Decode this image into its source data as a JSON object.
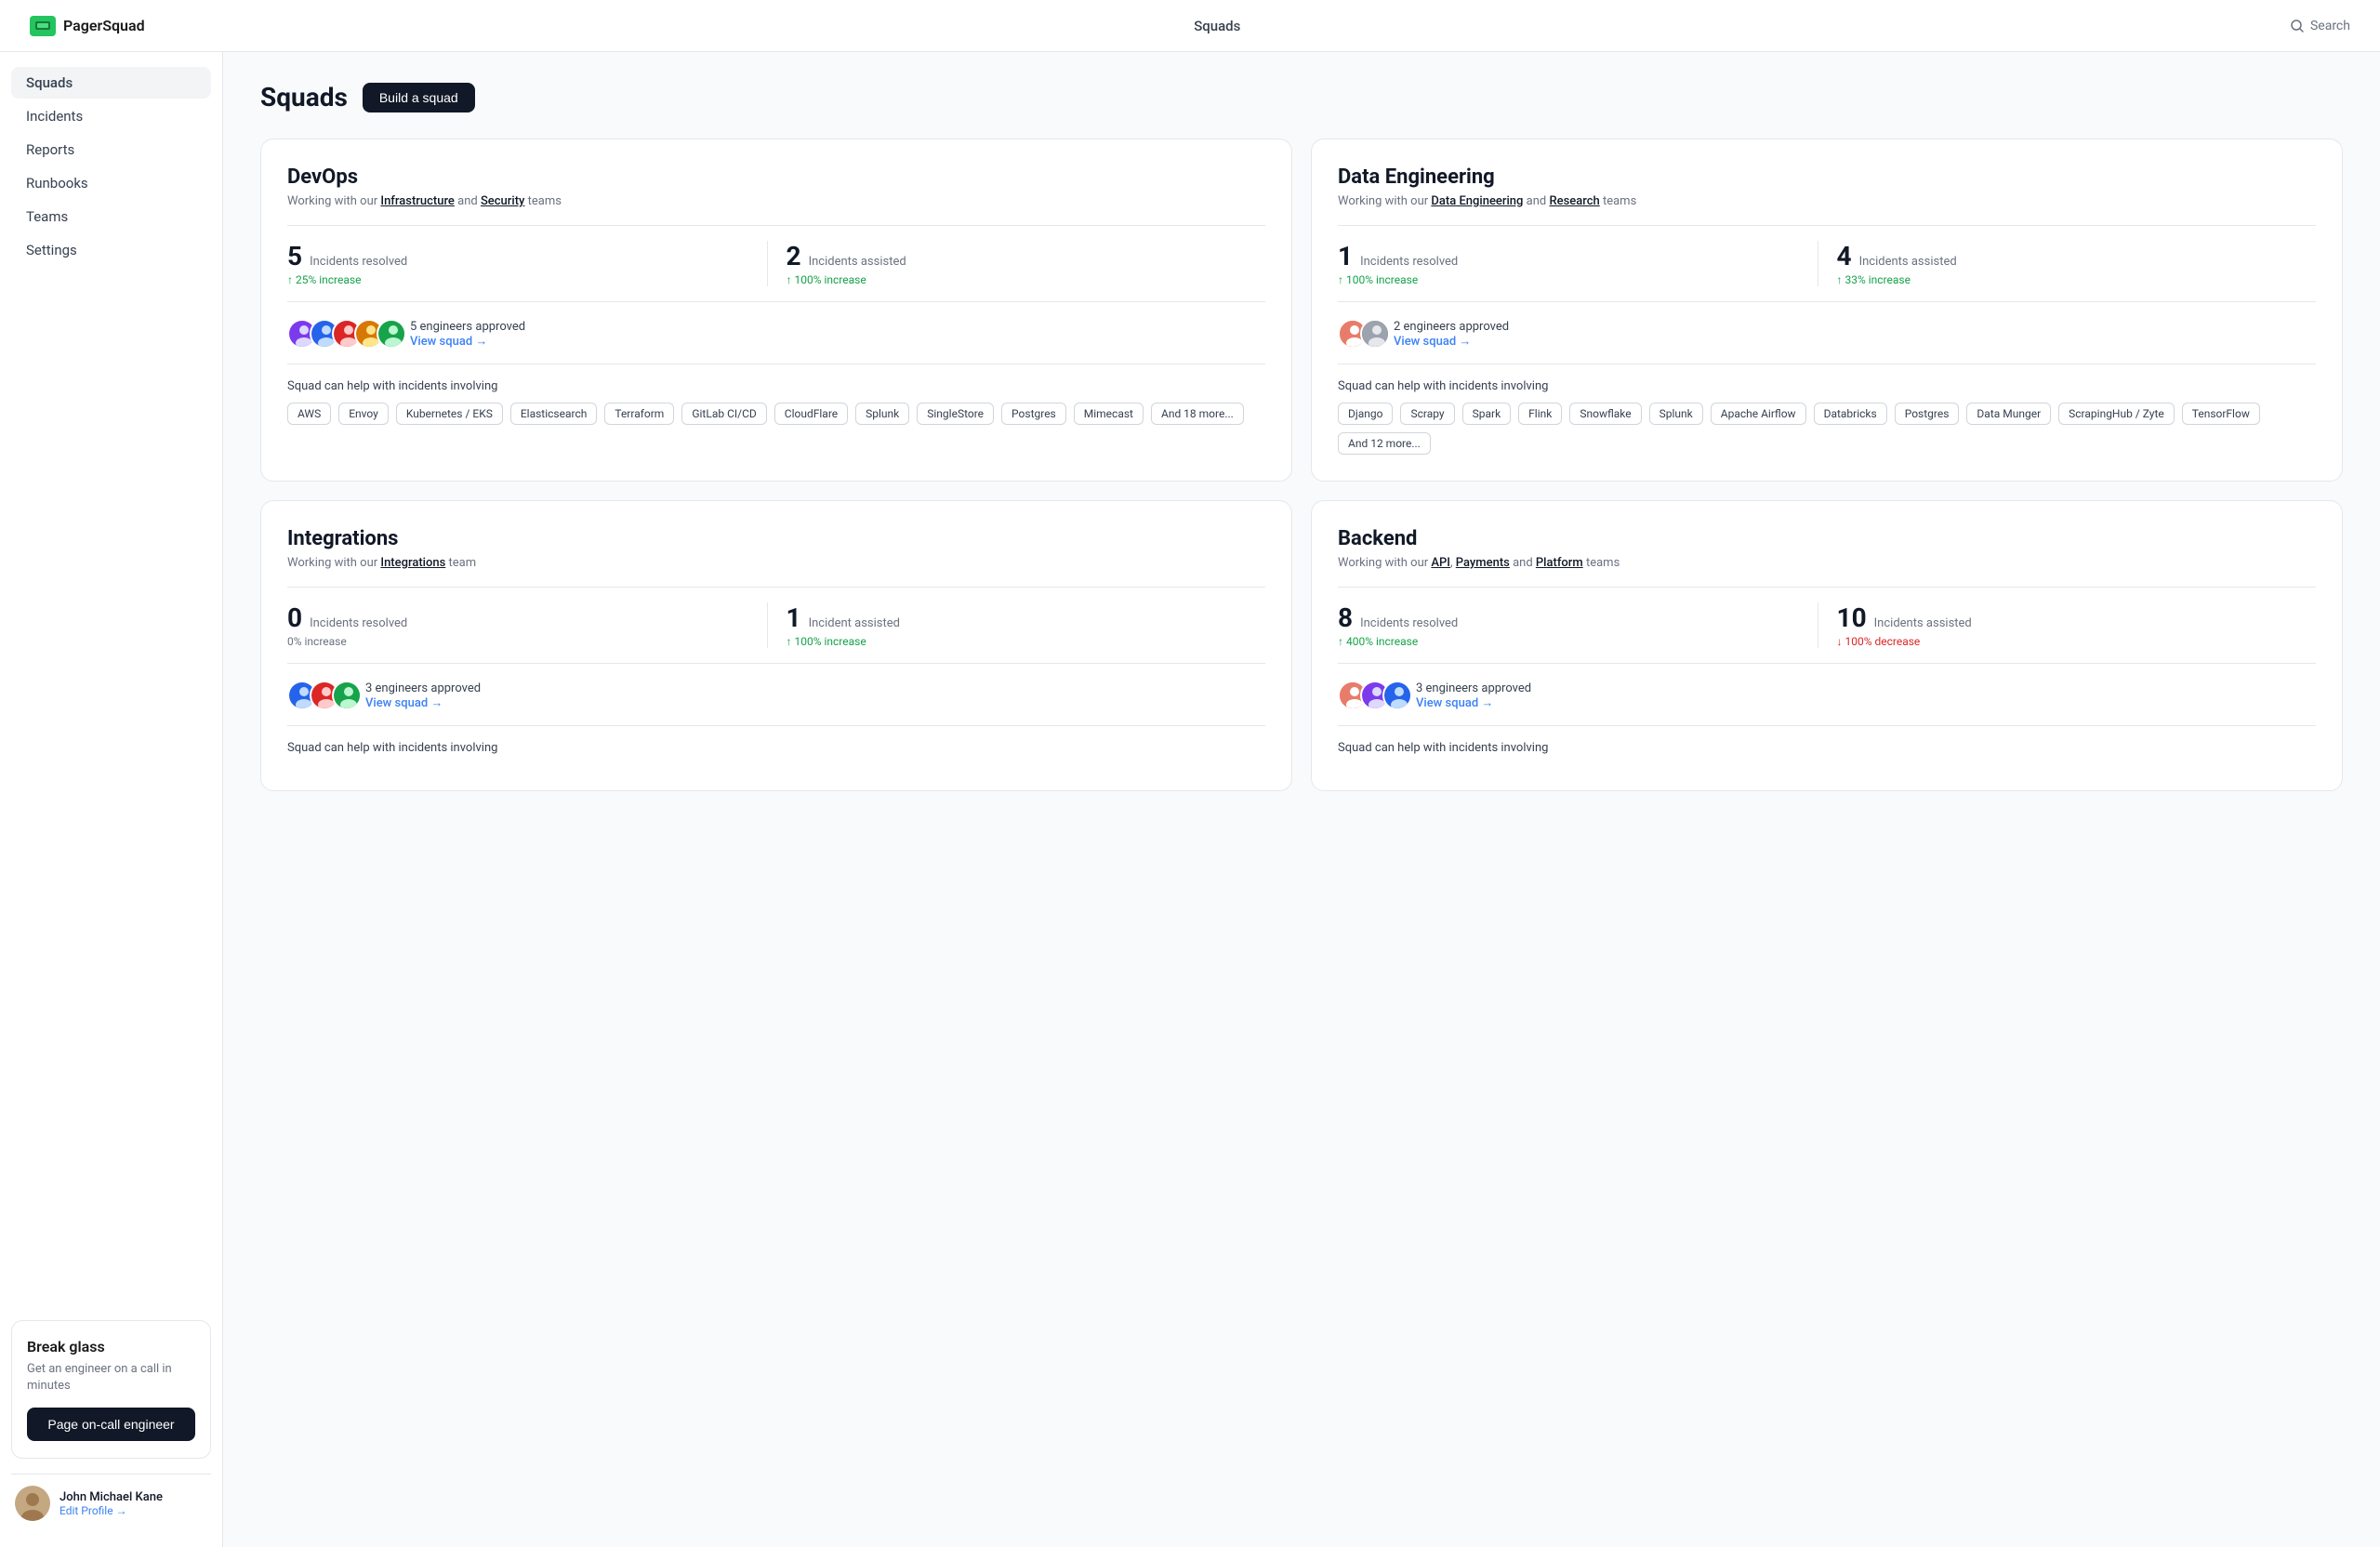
{
  "app": {
    "name": "PagerSquad",
    "top_title": "Squads",
    "search_label": "Search"
  },
  "sidebar": {
    "items": [
      {
        "label": "Squads",
        "active": true
      },
      {
        "label": "Incidents",
        "active": false
      },
      {
        "label": "Reports",
        "active": false
      },
      {
        "label": "Runbooks",
        "active": false
      },
      {
        "label": "Teams",
        "active": false
      },
      {
        "label": "Settings",
        "active": false
      }
    ],
    "break_glass": {
      "title": "Break glass",
      "desc": "Get an engineer on a call in minutes",
      "button": "Page on-call engineer"
    },
    "profile": {
      "name": "John Michael Kane",
      "edit_label": "Edit Profile →"
    }
  },
  "page": {
    "title": "Squads",
    "build_button": "Build a squad"
  },
  "squads": [
    {
      "id": "devops",
      "name": "DevOps",
      "desc_prefix": "Working with our ",
      "desc_links": [
        "Infrastructure",
        "Security"
      ],
      "desc_suffix": " teams",
      "stats": [
        {
          "number": "5",
          "label": "Incidents resolved",
          "change": "↑ 25% increase",
          "up": true
        },
        {
          "number": "2",
          "label": "Incidents assisted",
          "change": "↑ 100% increase",
          "up": true
        }
      ],
      "engineers_count": "5 engineers approved",
      "view_squad": "View squad →",
      "incidents_label": "Squad can help with incidents involving",
      "tags": [
        "AWS",
        "Envoy",
        "Kubernetes / EKS",
        "Elasticsearch",
        "Terraform",
        "GitLab CI/CD",
        "CloudFlare",
        "Splunk",
        "SingleStore",
        "Postgres",
        "Mimecast",
        "And 18 more..."
      ]
    },
    {
      "id": "data-engineering",
      "name": "Data Engineering",
      "desc_prefix": "Working with our ",
      "desc_links": [
        "Data Engineering",
        "Research"
      ],
      "desc_suffix": " teams",
      "stats": [
        {
          "number": "1",
          "label": "Incidents resolved",
          "change": "↑ 100% increase",
          "up": true
        },
        {
          "number": "4",
          "label": "Incidents assisted",
          "change": "↑ 33% increase",
          "up": true
        }
      ],
      "engineers_count": "2 engineers approved",
      "view_squad": "View squad →",
      "incidents_label": "Squad can help with incidents involving",
      "tags": [
        "Django",
        "Scrapy",
        "Spark",
        "Flink",
        "Snowflake",
        "Splunk",
        "Apache Airflow",
        "Databricks",
        "Postgres",
        "Data Munger",
        "ScrapingHub / Zyte",
        "TensorFlow",
        "And 12 more..."
      ]
    },
    {
      "id": "integrations",
      "name": "Integrations",
      "desc_prefix": "Working with our ",
      "desc_links": [
        "Integrations"
      ],
      "desc_suffix": " team",
      "stats": [
        {
          "number": "0",
          "label": "Incidents resolved",
          "change": "0% increase",
          "up": false
        },
        {
          "number": "1",
          "label": "Incident assisted",
          "change": "↑ 100% increase",
          "up": true
        }
      ],
      "engineers_count": "3 engineers approved",
      "view_squad": "View squad →",
      "incidents_label": "Squad can help with incidents involving",
      "tags": []
    },
    {
      "id": "backend",
      "name": "Backend",
      "desc_prefix": "Working with our ",
      "desc_links": [
        "API",
        "Payments",
        "Platform"
      ],
      "desc_suffix": " teams",
      "stats": [
        {
          "number": "8",
          "label": "Incidents resolved",
          "change": "↑ 400% increase",
          "up": true
        },
        {
          "number": "10",
          "label": "Incidents assisted",
          "change": "↓ 100% decrease",
          "up": false
        }
      ],
      "engineers_count": "3 engineers approved",
      "view_squad": "View squad →",
      "incidents_label": "Squad can help with incidents involving",
      "tags": []
    }
  ]
}
